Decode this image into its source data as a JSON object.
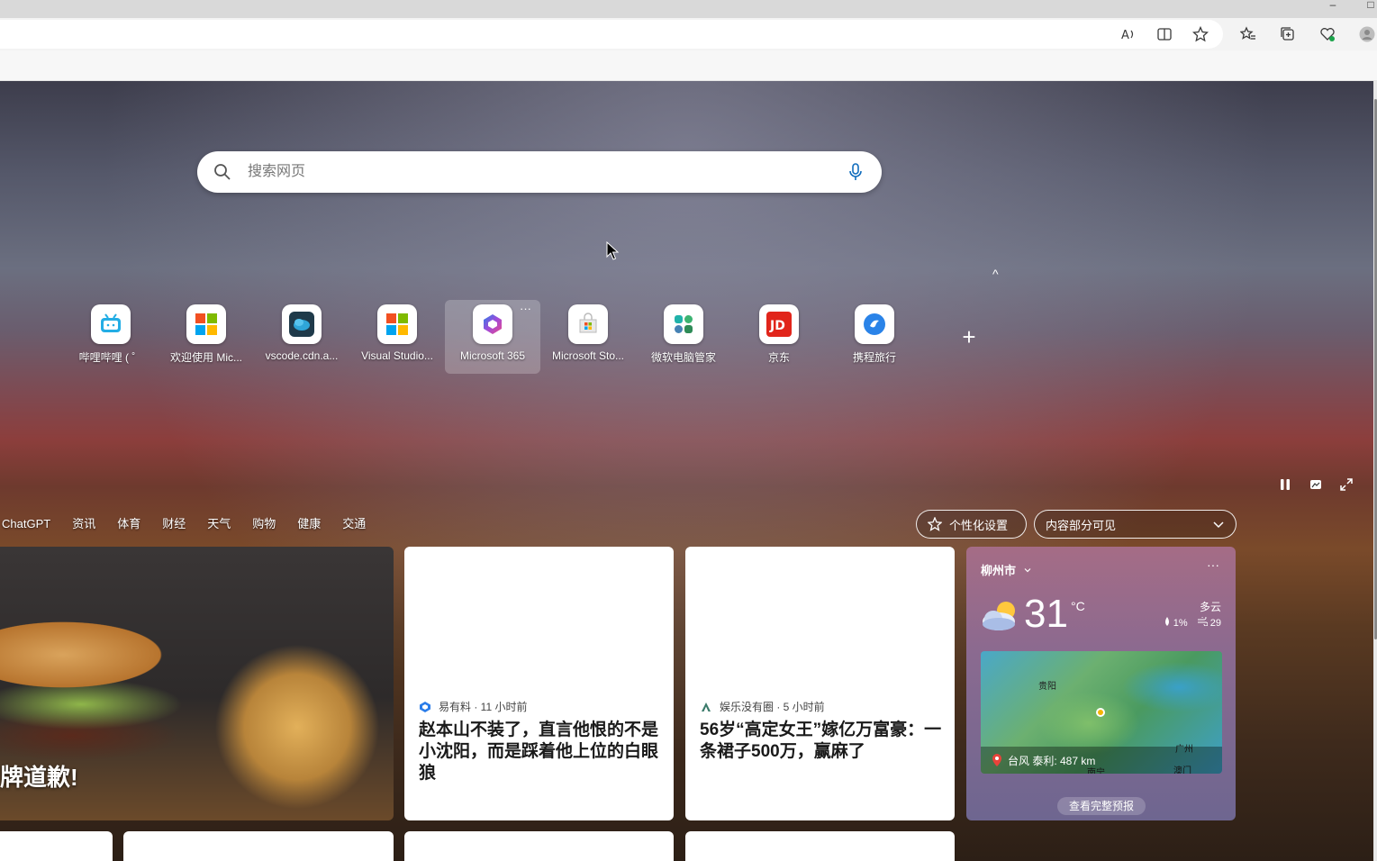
{
  "window": {
    "minimize_glyph": "–",
    "maximize_glyph": "□"
  },
  "toolbar": {
    "icons": [
      "read-aloud-icon",
      "split-screen-icon",
      "add-favorite-icon",
      "favorites-icon",
      "collections-icon",
      "browser-essentials-icon",
      "profile-avatar-icon"
    ]
  },
  "search": {
    "placeholder": "搜索网页"
  },
  "quick_links": [
    {
      "label": "哔哩哔哩 ( ゜",
      "icon": "bilibili-icon"
    },
    {
      "label": "欢迎使用 Mic...",
      "icon": "microsoft-logo-icon"
    },
    {
      "label": "vscode.cdn.a...",
      "icon": "vscode-cdn-icon"
    },
    {
      "label": "Visual Studio...",
      "icon": "microsoft-logo-icon"
    },
    {
      "label": "Microsoft 365",
      "icon": "microsoft-365-icon"
    },
    {
      "label": "Microsoft Sto...",
      "icon": "microsoft-store-icon"
    },
    {
      "label": "微软电脑管家",
      "icon": "pc-manager-icon"
    },
    {
      "label": "京东",
      "icon": "jd-icon"
    },
    {
      "label": "携程旅行",
      "icon": "ctrip-icon"
    }
  ],
  "tile_more_glyph": "···",
  "add_tile_glyph": "+",
  "collapse_glyph": "^",
  "nav_tabs": [
    "ChatGPT",
    "资讯",
    "体育",
    "财经",
    "天气",
    "购物",
    "健康",
    "交通"
  ],
  "personalize": {
    "label": "个性化设置"
  },
  "visibility_select": {
    "value": "内容部分可见"
  },
  "hero": {
    "title": "牌道歉!"
  },
  "news": [
    {
      "source": "易有料 · 11 小时前",
      "title": "赵本山不装了，直言他恨的不是小沈阳，而是踩着他上位的白眼狼"
    },
    {
      "source": "娱乐没有圈 · 5 小时前",
      "title": "56岁“高定女王”嫁亿万富豪：一条裙子500万，赢麻了"
    }
  ],
  "weather": {
    "city": "柳州市",
    "more_glyph": "···",
    "temperature": "31",
    "unit": "°C",
    "condition": "多云",
    "precipitation": "1%",
    "aqi": "29",
    "map_cities": [
      "贵阳",
      "广州",
      "南宁",
      "澳门"
    ],
    "typhoon": "台风 泰利: 487 km",
    "forecast_button": "查看完整预报"
  },
  "colors": {
    "accent": "#0f6cbd",
    "jd_red": "#e1251b"
  }
}
